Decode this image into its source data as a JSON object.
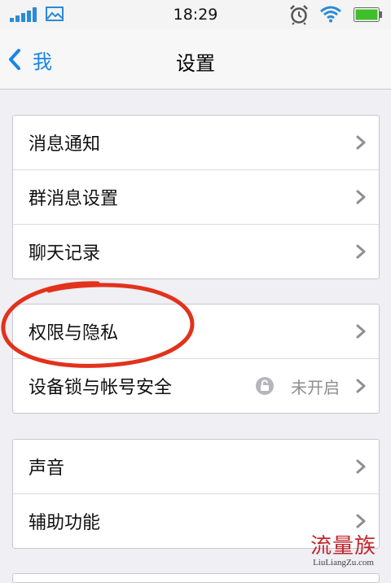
{
  "status_bar": {
    "time": "18:29"
  },
  "nav": {
    "back_label": "我",
    "title": "设置"
  },
  "groups": [
    {
      "rows": [
        {
          "label": "消息通知"
        },
        {
          "label": "群消息设置"
        },
        {
          "label": "聊天记录"
        }
      ]
    },
    {
      "rows": [
        {
          "label": "权限与隐私"
        },
        {
          "label": "设备锁与帐号安全",
          "value": "未开启"
        }
      ]
    },
    {
      "rows": [
        {
          "label": "声音"
        },
        {
          "label": "辅助功能"
        }
      ]
    }
  ],
  "watermark": {
    "cn": "流量族",
    "en": "LiuLiangZu.com"
  },
  "colors": {
    "accent": "#1a84e8",
    "annotation": "#e2321c",
    "battery": "#3fbf2a"
  }
}
